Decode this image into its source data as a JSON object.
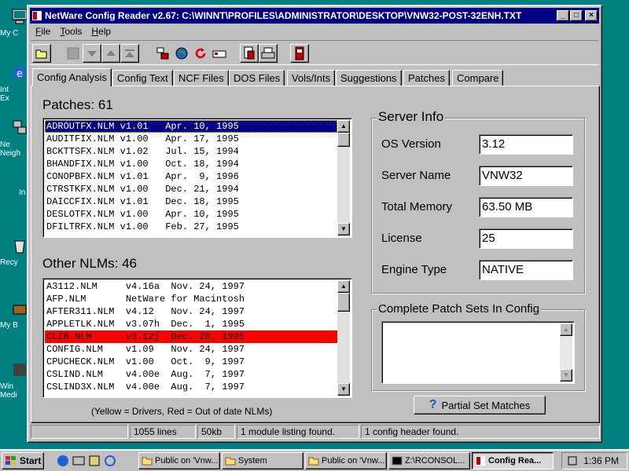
{
  "desktop": {
    "icons": [
      {
        "label": "My C"
      },
      {
        "label": "Int\nEx"
      },
      {
        "label": "Ne\nNeigh"
      },
      {
        "label": "In"
      },
      {
        "label": "Recy"
      },
      {
        "label": "My B"
      },
      {
        "label": "Win\nMedi"
      }
    ]
  },
  "window": {
    "title": "NetWare Config Reader v2.67:  C:\\WINNT\\PROFILES\\ADMINISTRATOR\\DESKTOP\\VNW32-POST-32ENH.TXT",
    "caption_buttons": {
      "minimize": "_",
      "maximize": "□",
      "close": "×"
    }
  },
  "menu": [
    {
      "key": "F",
      "rest": "ile"
    },
    {
      "key": "T",
      "rest": "ools"
    },
    {
      "key": "H",
      "rest": "elp"
    }
  ],
  "toolbar_icons": [
    "open-folder-icon",
    "disk-icon",
    "down-arrow-icon",
    "up-arrow-icon",
    "top-arrow-icon",
    "server-tree-icon",
    "globe-icon",
    "refresh-icon",
    "network-card-icon",
    "report-icon",
    "print-icon",
    "exit-door-icon"
  ],
  "tabs": [
    "Config Analysis",
    "Config Text",
    "NCF Files",
    "DOS Files",
    "Vols/Ints",
    "Suggestions",
    "Patches",
    "Compare"
  ],
  "patches": {
    "heading": "Patches: 61",
    "rows": [
      "ADROUTFX.NLM v1.01   Apr. 10, 1995",
      "AUDITFIX.NLM v1.00   Apr. 17, 1995",
      "BCKTTSFX.NLM v1.02   Jul. 15, 1994",
      "BHANDFIX.NLM v1.00   Oct. 18, 1994",
      "CONOPBFX.NLM v1.01   Apr.  9, 1996",
      "CTRSTKFX.NLM v1.00   Dec. 21, 1994",
      "DAICCFIX.NLM v1.01   Dec. 18, 1995",
      "DESLOTFX.NLM v1.00   Apr. 10, 1995",
      "DFILTRFX.NLM v1.00   Feb. 27, 1995"
    ]
  },
  "nlms": {
    "heading": "Other NLMs: 46",
    "rows": [
      "A3112.NLM     v4.16a  Nov. 24, 1997",
      "AFP.NLM       NetWare for Macintosh",
      "AFTER311.NLM  v4.12   Nov. 24, 1997",
      "APPLETLK.NLM  v3.07h  Dec.  1, 1995",
      "CLIB.NLM      v3.12j  Dec. 20, 1995",
      "CONFIG.NLM    v1.09   Nov. 24, 1997",
      "CPUCHECK.NLM  v1.00   Oct.  9, 1997",
      "CSLIND.NLM    v4.00e  Aug.  7, 1997",
      "CSLIND3X.NLM  v4.00e  Aug.  7, 1997"
    ],
    "outdated_index": 4
  },
  "legend_note": "(Yellow = Drivers, Red = Out of date NLMs)",
  "server_info": {
    "title": "Server Info",
    "fields": [
      {
        "label": "OS Version",
        "value": "3.12"
      },
      {
        "label": "Server Name",
        "value": "VNW32"
      },
      {
        "label": "Total Memory",
        "value": "63.50 MB"
      },
      {
        "label": "License",
        "value": "25"
      },
      {
        "label": "Engine Type",
        "value": "NATIVE"
      }
    ]
  },
  "patch_sets": {
    "title": "Complete Patch Sets In Config"
  },
  "partial_button": {
    "label": "Partial Set Matches",
    "icon": "?"
  },
  "status": [
    "",
    "1055 lines",
    "50kb",
    "1 module listing found.",
    "1 config header found."
  ],
  "taskbar": {
    "start": "Start",
    "tasks": [
      "Public on 'Vnw...",
      "System",
      "Public on 'Vnw...",
      "Z:\\RCONSOL...",
      "Config Rea..."
    ],
    "active_task": 4,
    "clock": "1:36 PM"
  },
  "colors": {
    "titlebar": "#000080",
    "selection": "#000080",
    "outdated": "#ff0000",
    "face": "#c0c0c0",
    "desktop": "#008080"
  }
}
